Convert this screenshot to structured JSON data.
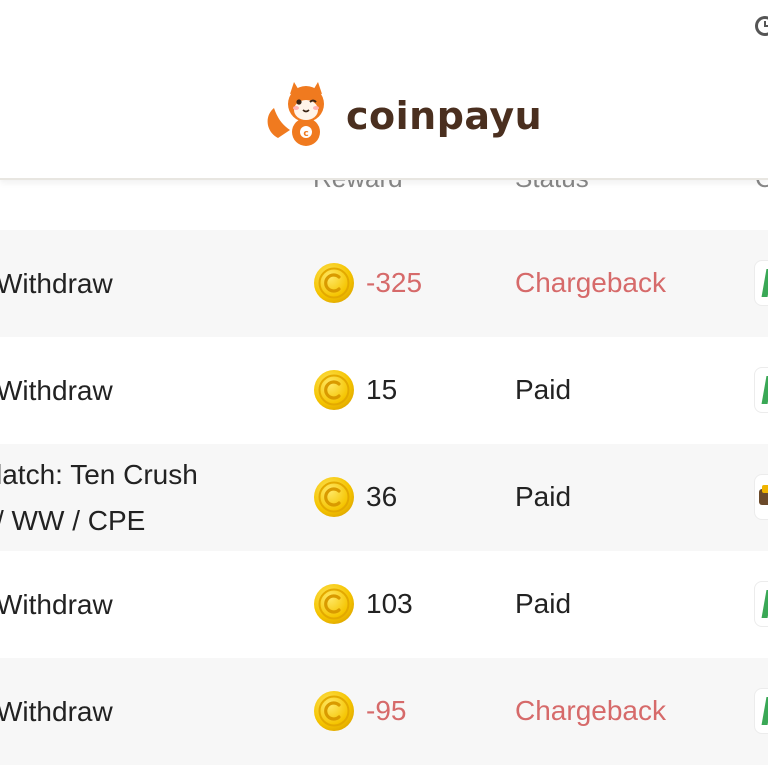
{
  "header": {
    "brand": "coinpayu"
  },
  "columns": {
    "reward": "Reward",
    "status": "Status",
    "extra": "C"
  },
  "rows": [
    {
      "type_lines": [
        "Withdraw"
      ],
      "amount": "-325",
      "status": "Chargeback",
      "negative": true,
      "action_icon": "green-bar-icon"
    },
    {
      "type_lines": [
        "Withdraw"
      ],
      "amount": "15",
      "status": "Paid",
      "negative": false,
      "action_icon": "green-bar-icon"
    },
    {
      "type_lines": [
        "latch: Ten Crush",
        "/ WW / CPE"
      ],
      "amount": "36",
      "status": "Paid",
      "negative": false,
      "action_icon": "badge-icon"
    },
    {
      "type_lines": [
        "Withdraw"
      ],
      "amount": "103",
      "status": "Paid",
      "negative": false,
      "action_icon": "green-bar-icon"
    },
    {
      "type_lines": [
        "Withdraw"
      ],
      "amount": "-95",
      "status": "Chargeback",
      "negative": true,
      "action_icon": "green-bar-icon"
    }
  ],
  "colors": {
    "negative": "#d66a6a",
    "brand": "#4a2f1f",
    "accent_orange": "#f07a1f",
    "coin": "#f5c400",
    "shaded_row": "#f7f7f7"
  }
}
